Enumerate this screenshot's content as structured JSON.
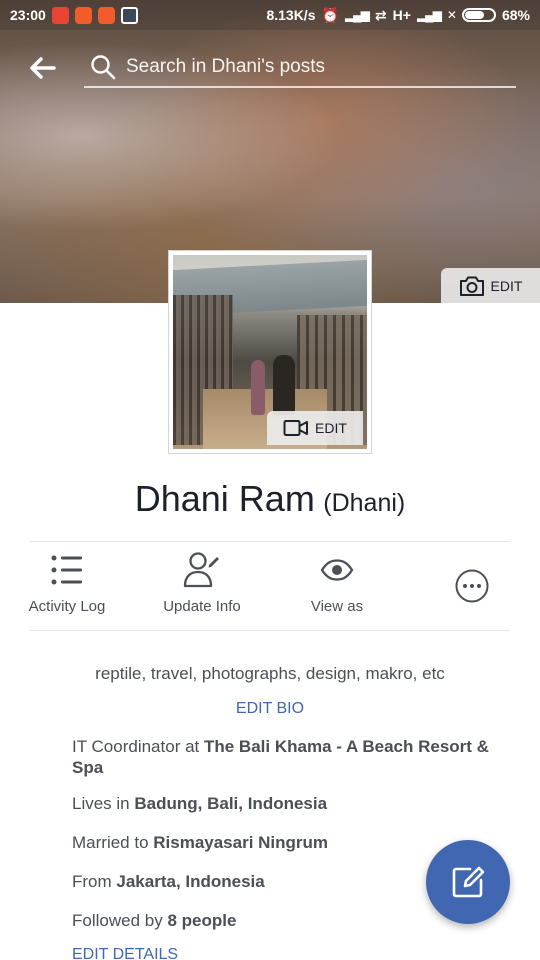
{
  "status_bar": {
    "time": "23:00",
    "speed": "8.13K/s",
    "network": "H+",
    "battery": "68%",
    "battery_level": 0.68
  },
  "search": {
    "placeholder": "Search in Dhani's posts"
  },
  "cover": {
    "edit_label": "EDIT"
  },
  "profile_picture": {
    "edit_label": "EDIT"
  },
  "profile": {
    "name": "Dhani Ram",
    "alternate_name": "(Dhani)"
  },
  "actions": [
    {
      "label": "Activity Log",
      "icon": "list-icon"
    },
    {
      "label": "Update Info",
      "icon": "edit-person-icon"
    },
    {
      "label": "View as",
      "icon": "eye-icon"
    },
    {
      "label": "",
      "icon": "more-icon"
    }
  ],
  "bio": {
    "text": "reptile, travel, photographs,  design, makro, etc",
    "edit_label": "EDIT BIO"
  },
  "details": {
    "work_prefix": "IT Coordinator at ",
    "work_value": "The Bali Khama - A Beach Resort & Spa",
    "lives_prefix": "Lives in ",
    "lives_value": "Badung, Bali, Indonesia",
    "married_prefix": "Married to ",
    "married_value": "Rismayasari Ningrum",
    "from_prefix": "From ",
    "from_value": "Jakarta, Indonesia",
    "followed_prefix": "Followed by ",
    "followed_value": "8 people",
    "edit_label": "EDIT DETAILS"
  },
  "colors": {
    "accent": "#4267b2",
    "text": "#1d2129",
    "secondary_text": "#4b4f56"
  }
}
